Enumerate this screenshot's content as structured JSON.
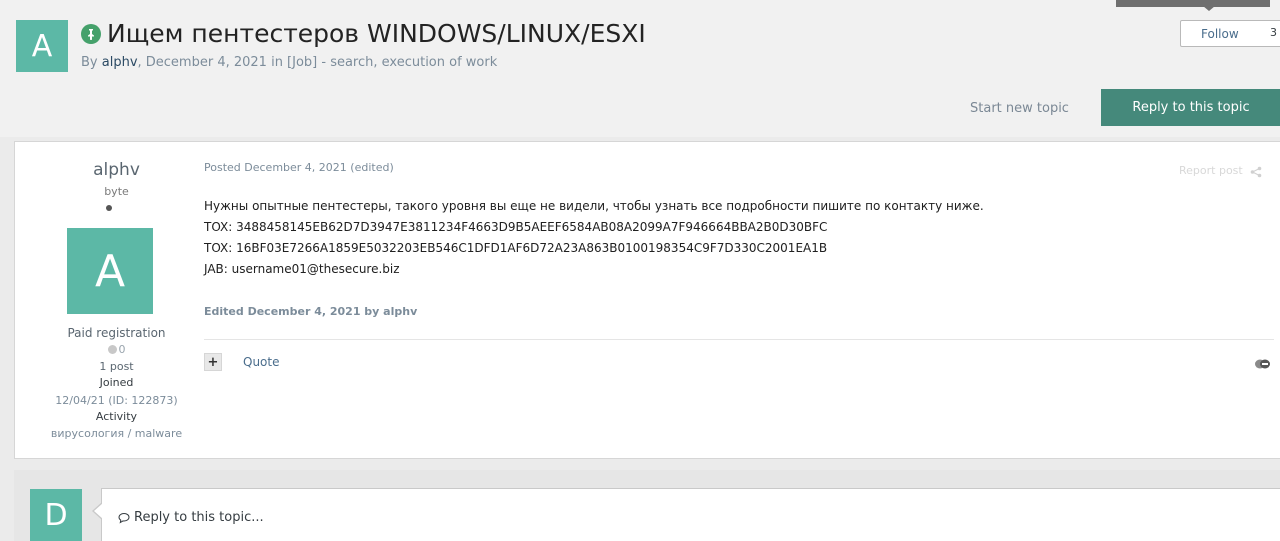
{
  "topic": {
    "avatar_letter": "A",
    "title": "Ищем пентестеров WINDOWS/LINUX/ESXI",
    "by_prefix": "By ",
    "author": "alphv",
    "byline_rest": ", December 4, 2021 in [Job] - search, execution of work",
    "pinned_icon": "pin-icon"
  },
  "actions": {
    "follow_label": "Follow",
    "follow_count": "3",
    "start_new_label": "Start new topic",
    "reply_label": "Reply to this topic"
  },
  "post": {
    "author_name": "alphv",
    "author_rank": "byte",
    "avatar_letter": "A",
    "group": "Paid registration",
    "reputation": "0",
    "posts_count": "1 post",
    "joined_label": "Joined",
    "joined_value": "12/04/21 (ID: 122873)",
    "activity_label": "Activity",
    "activity_value": "вирусология / malware",
    "posted": "Posted December 4, 2021 (edited)",
    "report_label": "Report post",
    "body": [
      "Нужны опытные пентестеры, такого уровня вы еще не видели, чтобы узнать все подробности пишите по контакту ниже.",
      "TOX: 3488458145EB62D7D3947E3811234F4663D9B5AEEF6584AB08A2099A7F946664BBA2B0D30BFC",
      "TOX: 16BF03E7266A1859E5032203EB546C1DFD1AF6D72A23A863B0100198354C9F7D330C2001EA1B",
      "JAB: username01@thesecure.biz"
    ],
    "edited": "Edited December 4, 2021 by alphv",
    "plus_label": "+",
    "quote_label": "Quote"
  },
  "reply": {
    "avatar_letter": "D",
    "placeholder": "Reply to this topic..."
  },
  "colors": {
    "accent": "#5cb8a6",
    "reply_button": "#45897b",
    "pin": "#45a16b"
  }
}
